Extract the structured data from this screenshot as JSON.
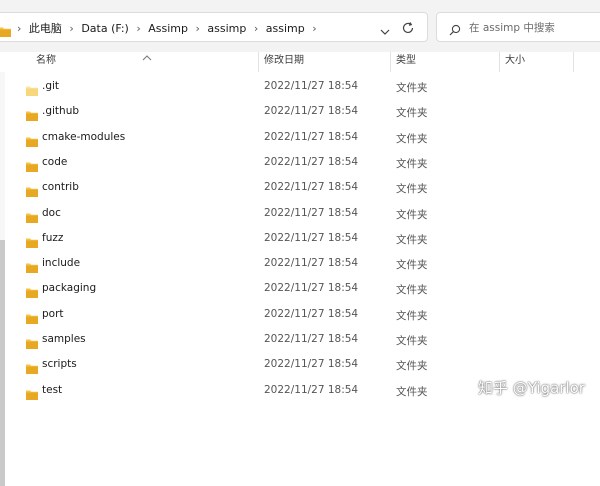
{
  "breadcrumb": [
    "此电脑",
    "Data (F:)",
    "Assimp",
    "assimp",
    "assimp"
  ],
  "search": {
    "placeholder": "在 assimp 中搜索"
  },
  "columns": {
    "name": "名称",
    "date": "修改日期",
    "type": "类型",
    "size": "大小"
  },
  "files": [
    {
      "name": ".git",
      "date": "2022/11/27 18:54",
      "type": "文件夹"
    },
    {
      "name": ".github",
      "date": "2022/11/27 18:54",
      "type": "文件夹"
    },
    {
      "name": "cmake-modules",
      "date": "2022/11/27 18:54",
      "type": "文件夹"
    },
    {
      "name": "code",
      "date": "2022/11/27 18:54",
      "type": "文件夹"
    },
    {
      "name": "contrib",
      "date": "2022/11/27 18:54",
      "type": "文件夹"
    },
    {
      "name": "doc",
      "date": "2022/11/27 18:54",
      "type": "文件夹"
    },
    {
      "name": "fuzz",
      "date": "2022/11/27 18:54",
      "type": "文件夹"
    },
    {
      "name": "include",
      "date": "2022/11/27 18:54",
      "type": "文件夹"
    },
    {
      "name": "packaging",
      "date": "2022/11/27 18:54",
      "type": "文件夹"
    },
    {
      "name": "port",
      "date": "2022/11/27 18:54",
      "type": "文件夹"
    },
    {
      "name": "samples",
      "date": "2022/11/27 18:54",
      "type": "文件夹"
    },
    {
      "name": "scripts",
      "date": "2022/11/27 18:54",
      "type": "文件夹"
    },
    {
      "name": "test",
      "date": "2022/11/27 18:54",
      "type": "文件夹"
    }
  ],
  "watermark": "知乎 @Yigarlor",
  "colors": {
    "folder": "#f8c246",
    "folder_dark": "#e7a823"
  }
}
